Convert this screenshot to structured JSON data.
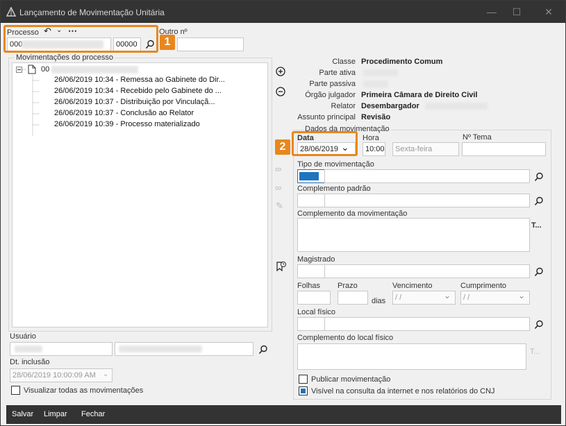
{
  "window": {
    "title": "Lançamento de Movimentação Unitária",
    "controls": [
      "minimize",
      "maximize",
      "close"
    ]
  },
  "processo": {
    "label": "Processo",
    "number_prefix": "000",
    "number_suffix": "00000",
    "outro_label": "Outro nº",
    "outro_value": ""
  },
  "badges": {
    "one": "1",
    "two": "2"
  },
  "movimentacoes": {
    "label": "Movimentações do processo",
    "root": "00",
    "items": [
      "26/06/2019 10:34 - Remessa ao Gabinete do Dir...",
      "26/06/2019 10:34 - Recebido pelo Gabinete do ...",
      "26/06/2019 10:37 - Distribuição por Vinculaçã...",
      "26/06/2019 10:37 - Conclusão ao Relator",
      "26/06/2019 10:39 - Processo materializado"
    ]
  },
  "info": {
    "classe_label": "Classe",
    "classe_value": "Procedimento Comum",
    "parte_ativa_label": "Parte ativa",
    "parte_passiva_label": "Parte passiva",
    "orgao_label": "Órgão julgador",
    "orgao_value": "Primeira Câmara de Direito Civil",
    "relator_label": "Relator",
    "relator_value": "Desembargador",
    "assunto_label": "Assunto principal",
    "assunto_value": "Revisão"
  },
  "dados": {
    "label": "Dados da movimentação",
    "data_label": "Data",
    "data_value": "28/06/2019",
    "hora_label": "Hora",
    "hora_value": "10:00",
    "weekday": "Sexta-feira",
    "tema_label": "Nº Tema",
    "tema_value": "",
    "tipo_label": "Tipo de movimentação",
    "complemento_padrao_label": "Complemento padrão",
    "complemento_mov_label": "Complemento da movimentação",
    "complemento_mov_side": "T...",
    "magistrado_label": "Magistrado",
    "folhas_label": "Folhas",
    "prazo_label": "Prazo",
    "dias_label": "dias",
    "vencimento_label": "Vencimento",
    "vencimento_value": "/ /",
    "cumprimento_label": "Cumprimento",
    "cumprimento_value": "/ /",
    "local_label": "Local físico",
    "complemento_local_label": "Complemento do local físico",
    "complemento_local_side": "T...",
    "publicar_label": "Publicar movimentação",
    "publicar_checked": false,
    "visivel_label": "Visível na consulta da internet e nos relatórios do CNJ",
    "visivel_checked": true
  },
  "usuario": {
    "label": "Usuário",
    "dt_label": "Dt. inclusão",
    "dt_value": "28/06/2019 10:00:09 AM",
    "visualizar_label": "Visualizar todas as movimentações",
    "visualizar_checked": false
  },
  "footer": {
    "salvar": "Salvar",
    "limpar": "Limpar",
    "fechar": "Fechar"
  },
  "colors": {
    "titlebar": "#333333",
    "highlight": "#e8871e",
    "accent": "#1e73be"
  }
}
